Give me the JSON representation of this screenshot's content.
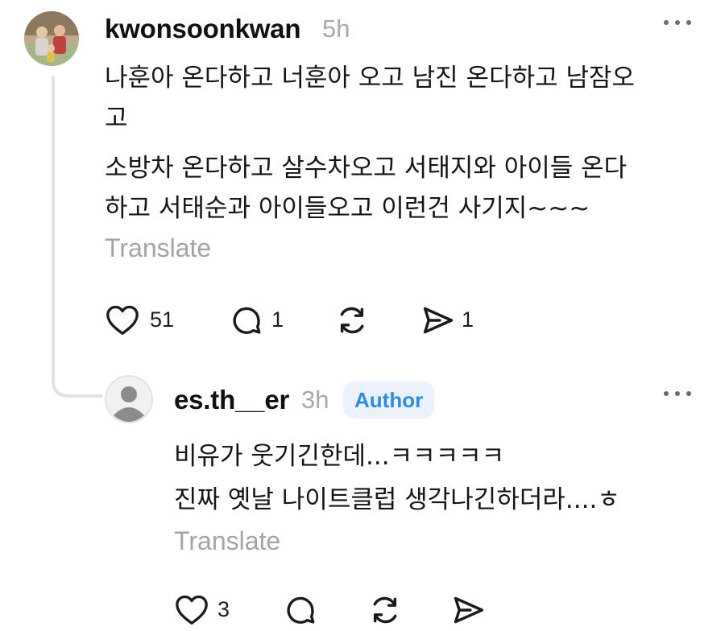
{
  "comment": {
    "username": "kwonsoonkwan",
    "time": "5h",
    "more": "…",
    "lines": [
      "나훈아 온다하고 너훈아 오고 남진 온다하고 남잠오",
      "고",
      "소방차 온다하고 살수차오고 서태지와 아이들 온다",
      "하고 서태순과 아이들오고 이런건 사기지~~~"
    ],
    "translate": "Translate",
    "likes": "51",
    "replies": "1",
    "shares": "1"
  },
  "reply": {
    "username": "es.th__er",
    "time": "3h",
    "badge": "Author",
    "more": "…",
    "lines": [
      "비유가 웃기긴한데...ㅋㅋㅋㅋㅋ",
      "진짜 옛날 나이트클럽 생각나긴하더라....ㅎ"
    ],
    "translate": "Translate",
    "likes": "3"
  },
  "colors": {
    "text": "#151515",
    "muted": "#a4a4a4",
    "badge_bg": "#eaf3fd",
    "badge_text": "#2f8cdd",
    "thread_line": "#e2e2e2"
  },
  "icons": [
    "heart-icon",
    "comment-icon",
    "repost-icon",
    "share-icon",
    "more-icon",
    "default-avatar-icon"
  ]
}
